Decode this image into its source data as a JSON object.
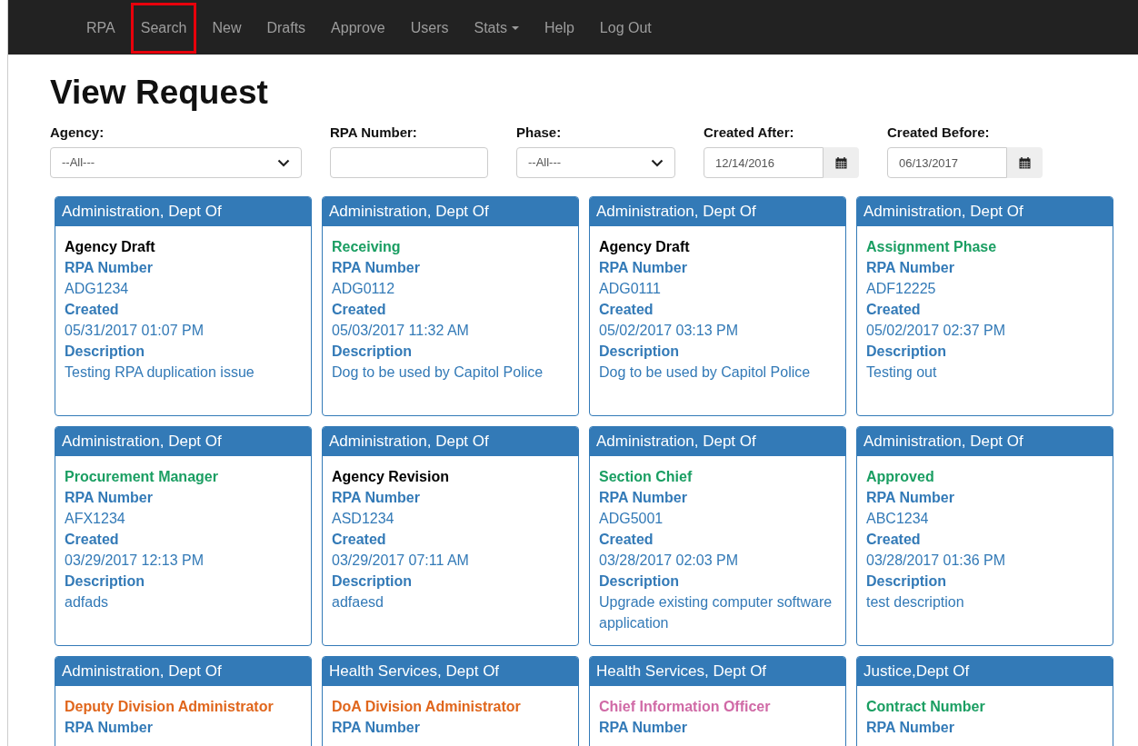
{
  "nav": [
    {
      "label": "RPA",
      "highlighted": false,
      "caret": false
    },
    {
      "label": "Search",
      "highlighted": true,
      "caret": false
    },
    {
      "label": "New",
      "highlighted": false,
      "caret": false
    },
    {
      "label": "Drafts",
      "highlighted": false,
      "caret": false
    },
    {
      "label": "Approve",
      "highlighted": false,
      "caret": false
    },
    {
      "label": "Users",
      "highlighted": false,
      "caret": false
    },
    {
      "label": "Stats",
      "highlighted": false,
      "caret": true
    },
    {
      "label": "Help",
      "highlighted": false,
      "caret": false
    },
    {
      "label": "Log Out",
      "highlighted": false,
      "caret": false
    }
  ],
  "title": "View Request",
  "filters": [
    {
      "kind": "select",
      "label": "Agency:",
      "value": "--All---"
    },
    {
      "kind": "text",
      "label": "RPA Number:"
    },
    {
      "kind": "select",
      "label": "Phase:",
      "value": "--All---"
    },
    {
      "kind": "date",
      "label": "Created After:",
      "value": "12/14/2016"
    },
    {
      "kind": "date",
      "label": "Created Before:",
      "value": "06/13/2017"
    }
  ],
  "cards": [
    {
      "agency": "Administration, Dept Of",
      "phase": "Agency Draft",
      "color": "#000000",
      "number_label": "RPA Number",
      "number": "ADG1234",
      "created_label": "Created",
      "created": "05/31/2017 01:07 PM",
      "description_label": "Description",
      "description": "Testing RPA duplication issue"
    },
    {
      "agency": "Administration, Dept Of",
      "phase": "Receiving",
      "color": "#1a9e62",
      "number_label": "RPA Number",
      "number": "ADG0112",
      "created_label": "Created",
      "created": "05/03/2017 11:32 AM",
      "description_label": "Description",
      "description": "Dog to be used by Capitol Police"
    },
    {
      "agency": "Administration, Dept Of",
      "phase": "Agency Draft",
      "color": "#000000",
      "number_label": "RPA Number",
      "number": "ADG0111",
      "created_label": "Created",
      "created": "05/02/2017 03:13 PM",
      "description_label": "Description",
      "description": "Dog to be used by Capitol Police"
    },
    {
      "agency": "Administration, Dept Of",
      "phase": "Assignment Phase",
      "color": "#1a9e62",
      "number_label": "RPA Number",
      "number": "ADF12225",
      "created_label": "Created",
      "created": "05/02/2017 02:37 PM",
      "description_label": "Description",
      "description": "Testing out"
    },
    {
      "agency": "Administration, Dept Of",
      "phase": "Procurement Manager",
      "color": "#1a9e62",
      "number_label": "RPA Number",
      "number": "AFX1234",
      "created_label": "Created",
      "created": "03/29/2017 12:13 PM",
      "description_label": "Description",
      "description": "adfads"
    },
    {
      "agency": "Administration, Dept Of",
      "phase": "Agency Revision",
      "color": "#000000",
      "number_label": "RPA Number",
      "number": "ASD1234",
      "created_label": "Created",
      "created": "03/29/2017 07:11 AM",
      "description_label": "Description",
      "description": "adfaesd"
    },
    {
      "agency": "Administration, Dept Of",
      "phase": "Section Chief",
      "color": "#1a9e62",
      "number_label": "RPA Number",
      "number": "ADG5001",
      "created_label": "Created",
      "created": "03/28/2017 02:03 PM",
      "description_label": "Description",
      "description": "Upgrade existing computer software application"
    },
    {
      "agency": "Administration, Dept Of",
      "phase": "Approved",
      "color": "#1a9e62",
      "number_label": "RPA Number",
      "number": "ABC1234",
      "created_label": "Created",
      "created": "03/28/2017 01:36 PM",
      "description_label": "Description",
      "description": "test description"
    },
    {
      "agency": "Administration, Dept Of",
      "phase": "Deputy Division Administrator",
      "color": "#e0661c",
      "number_label": "RPA Number"
    },
    {
      "agency": "Health Services, Dept Of",
      "phase": "DoA Division Administrator",
      "color": "#e0661c",
      "number_label": "RPA Number"
    },
    {
      "agency": "Health Services, Dept Of",
      "phase": "Chief Information Officer",
      "color": "#d06aa6",
      "number_label": "RPA Number"
    },
    {
      "agency": "Justice,Dept Of",
      "phase": "Contract Number",
      "color": "#1a9e62",
      "number_label": "RPA Number"
    }
  ]
}
